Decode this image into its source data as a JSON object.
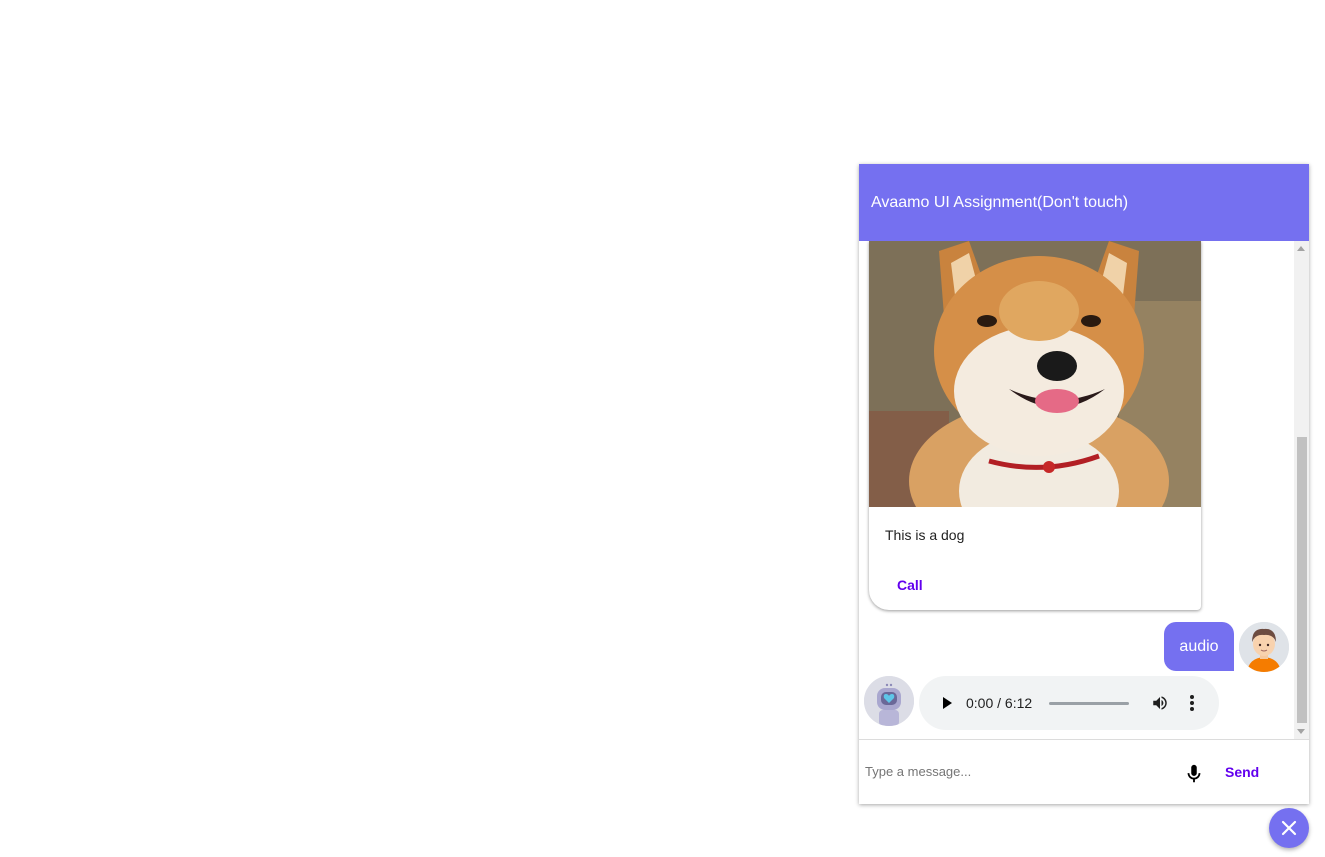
{
  "chat": {
    "title": "Avaamo UI Assignment(Don't touch)",
    "card": {
      "image_subject": "shiba inu dog photo",
      "text": "This is a dog",
      "button_label": "Call"
    },
    "user_message": "audio",
    "audio": {
      "time": "0:00 / 6:12",
      "progress": 0
    },
    "input": {
      "placeholder": "Type a message...",
      "value": ""
    },
    "send_label": "Send"
  },
  "icons": {
    "microphone": "mic-icon",
    "close": "close-icon",
    "play": "play-icon",
    "volume": "volume-icon",
    "more": "more-vert-icon"
  },
  "colors": {
    "header": "#7570f0",
    "accent": "#6200ee",
    "user_bubble": "#7570f0",
    "fab": "#7570f0"
  }
}
